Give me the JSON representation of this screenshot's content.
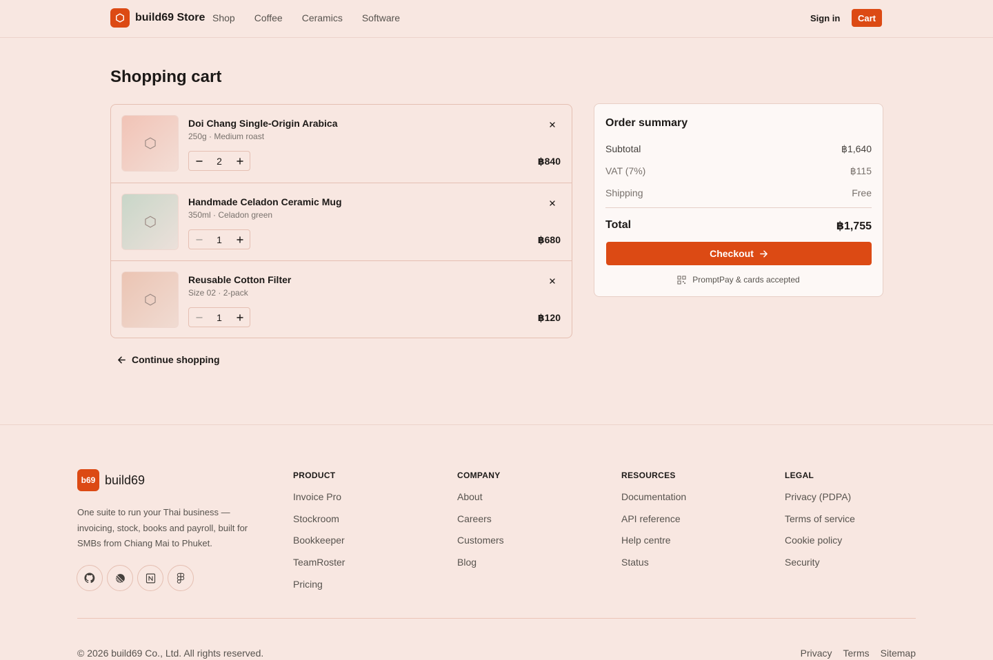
{
  "header": {
    "brand": "build69 Store",
    "nav": [
      "Shop",
      "Coffee",
      "Ceramics",
      "Software"
    ],
    "sign_in": "Sign in",
    "cart": "Cart"
  },
  "page_title": "Shopping cart",
  "cart": {
    "items": [
      {
        "name": "Doi Chang Single-Origin Arabica",
        "meta": "250g · Medium roast",
        "qty": "2",
        "price": "฿840",
        "thumb_colors": [
          "#f1c3b6",
          "#f3ddd5"
        ]
      },
      {
        "name": "Handmade Celadon Ceramic Mug",
        "meta": "350ml · Celadon green",
        "qty": "1",
        "price": "฿680",
        "thumb_colors": [
          "#c8d6c8",
          "#ece0da"
        ]
      },
      {
        "name": "Reusable Cotton Filter",
        "meta": "Size 02 · 2-pack",
        "qty": "1",
        "price": "฿120",
        "thumb_colors": [
          "#ebc4b3",
          "#f0dbd2"
        ]
      }
    ],
    "continue": "Continue shopping"
  },
  "summary": {
    "title": "Order summary",
    "subtotal_label": "Subtotal",
    "subtotal": "฿1,640",
    "vat_label": "VAT (7%)",
    "vat": "฿115",
    "shipping_label": "Shipping",
    "shipping": "Free",
    "total_label": "Total",
    "total": "฿1,755",
    "checkout": "Checkout",
    "accepted": "PromptPay & cards accepted"
  },
  "footer": {
    "badge": "b69",
    "brand": "build69",
    "description": "One suite to run your Thai business — invoicing, stock, books and payroll, built for SMBs from Chiang Mai to Phuket.",
    "columns": [
      {
        "title": "PRODUCT",
        "links": [
          "Invoice Pro",
          "Stockroom",
          "Bookkeeper",
          "TeamRoster",
          "Pricing"
        ]
      },
      {
        "title": "COMPANY",
        "links": [
          "About",
          "Careers",
          "Customers",
          "Blog"
        ]
      },
      {
        "title": "RESOURCES",
        "links": [
          "Documentation",
          "API reference",
          "Help centre",
          "Status"
        ]
      },
      {
        "title": "LEGAL",
        "links": [
          "Privacy (PDPA)",
          "Terms of service",
          "Cookie policy",
          "Security"
        ]
      }
    ],
    "copyright": "© 2026 build69 Co., Ltd. All rights reserved.",
    "bottom_links": [
      "Privacy",
      "Terms",
      "Sitemap"
    ]
  },
  "colors": {
    "accent": "#dc4a14",
    "background": "#f8e7e1",
    "card": "#fdf8f6"
  }
}
